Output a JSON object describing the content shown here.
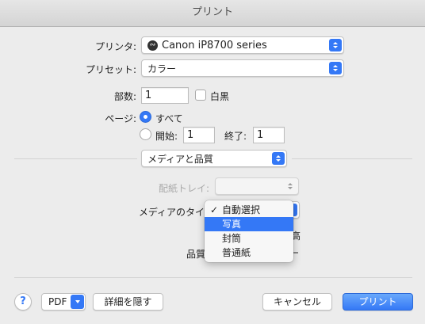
{
  "window": {
    "title": "プリント"
  },
  "printer": {
    "label": "プリンタ:",
    "value": "Canon iP8700 series",
    "icon": "printer-icon"
  },
  "presets": {
    "label": "プリセット:",
    "value": "カラー"
  },
  "copies": {
    "label": "部数:",
    "value": "1",
    "bw_label": "白黒"
  },
  "pages": {
    "label": "ページ:",
    "all_label": "すべて",
    "from_label": "開始:",
    "from_value": "1",
    "to_label": "終了:",
    "to_value": "1"
  },
  "section": {
    "value": "メディアと品質"
  },
  "paper_tray": {
    "label": "配紙トレイ:",
    "value": ""
  },
  "media_type": {
    "label": "メディアのタイプ",
    "options": [
      "自動選択",
      "写真",
      "封筒",
      "普通紙"
    ],
    "selected": "自動選択",
    "highlighted": "写真",
    "check_mark": "✓"
  },
  "quality": {
    "label": "品質",
    "partial_text": "高"
  },
  "footer": {
    "help": "?",
    "pdf": "PDF",
    "hide_details": "詳細を隠す",
    "cancel": "キャンセル",
    "print": "プリント"
  }
}
